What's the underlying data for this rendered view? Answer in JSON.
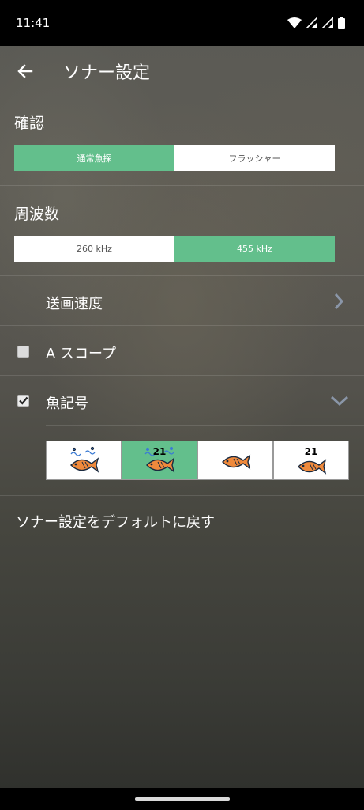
{
  "status_bar": {
    "time": "11:41"
  },
  "app_bar": {
    "title": "ソナー設定"
  },
  "confirm": {
    "title": "確認",
    "options": [
      "通常魚探",
      "フラッシャー"
    ],
    "selected": 0
  },
  "frequency": {
    "title": "周波数",
    "options": [
      "260 kHz",
      "455 kHz"
    ],
    "selected": 1
  },
  "scroll_speed": {
    "label": "送画速度"
  },
  "a_scope": {
    "label": "A スコープ",
    "checked": false
  },
  "fish_symbol": {
    "label": "魚記号",
    "checked": true,
    "options": [
      {
        "icon": "fish-with-bubbles-icon",
        "number": ""
      },
      {
        "icon": "fish-with-bubbles-depth-icon",
        "number": "21"
      },
      {
        "icon": "fish-icon",
        "number": ""
      },
      {
        "icon": "fish-depth-icon",
        "number": "21"
      }
    ],
    "selected": 1
  },
  "reset": {
    "label": "ソナー設定をデフォルトに戻す"
  },
  "colors": {
    "accent": "#63bf8c",
    "fish": "#f08a3c"
  }
}
